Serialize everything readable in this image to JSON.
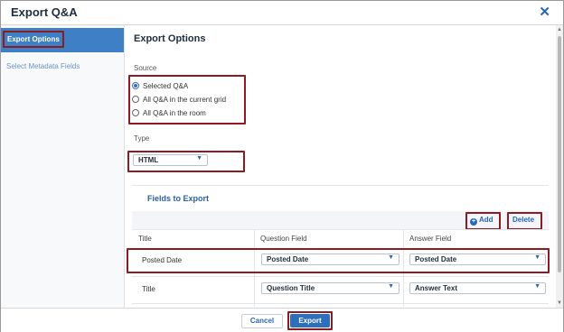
{
  "window": {
    "title": "Export Q&A",
    "close_glyph": "✕"
  },
  "sidebar": {
    "items": [
      {
        "label": "Export Options"
      },
      {
        "label": "Select Metadata Fields"
      }
    ]
  },
  "main": {
    "heading": "Export Options",
    "source": {
      "label": "Source",
      "options": [
        {
          "label": "Selected Q&A",
          "selected": true
        },
        {
          "label": "All Q&A in the current grid",
          "selected": false
        },
        {
          "label": "All Q&A in the room",
          "selected": false
        }
      ]
    },
    "type": {
      "label": "Type",
      "value": "HTML"
    },
    "fields": {
      "title": "Fields to Export",
      "add_label": "Add",
      "delete_label": "Delete",
      "columns": [
        "Title",
        "Question Field",
        "Answer Field"
      ],
      "rows": [
        {
          "title": "Posted Date",
          "question": "Posted Date",
          "answer": "Posted Date"
        },
        {
          "title": "Title",
          "question": "Question Title",
          "answer": "Answer Text"
        }
      ]
    }
  },
  "footer": {
    "cancel_label": "Cancel",
    "export_label": "Export"
  },
  "colors": {
    "accent": "#2e6fbc",
    "highlight_box": "#8c1b22",
    "sidebar_active": "#3f7fc6"
  }
}
